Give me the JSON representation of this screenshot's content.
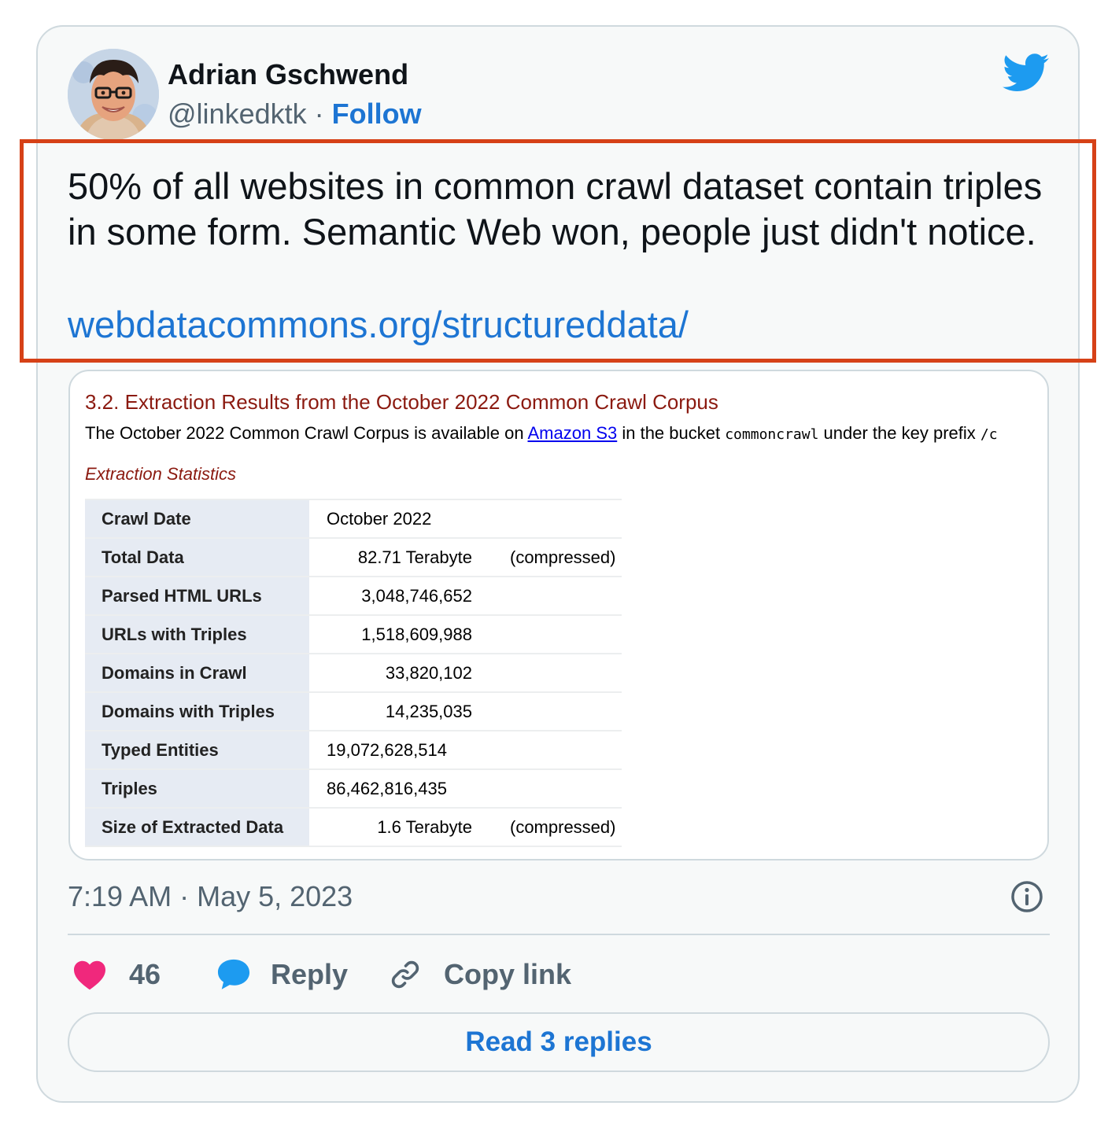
{
  "author": {
    "name": "Adrian Gschwend",
    "handle": "@linkedktk",
    "separator": "·",
    "follow_label": "Follow"
  },
  "tweet": {
    "text": "50% of all websites in common crawl dataset contain triples in some form. Semantic Web won, people just didn't notice.",
    "link": "webdatacommons.org/structureddata/"
  },
  "embed": {
    "section_title": "3.2. Extraction Results from the October 2022 Common Crawl Corpus",
    "desc_before": "The October 2022 Common Crawl Corpus is available on ",
    "desc_link": "Amazon S3",
    "desc_mid": " in the bucket ",
    "desc_code1": "commoncrawl",
    "desc_after": " under the key prefix ",
    "desc_code2": "/c",
    "stats_label": "Extraction Statistics",
    "rows": [
      {
        "key": "Crawl Date",
        "value": "October 2022",
        "note": ""
      },
      {
        "key": "Total Data",
        "value": "82.71 Terabyte",
        "note": "(compressed)"
      },
      {
        "key": "Parsed HTML URLs",
        "value": "3,048,746,652",
        "note": ""
      },
      {
        "key": "URLs with Triples",
        "value": "1,518,609,988",
        "note": ""
      },
      {
        "key": "Domains in Crawl",
        "value": "33,820,102",
        "note": ""
      },
      {
        "key": "Domains with Triples",
        "value": "14,235,035",
        "note": ""
      },
      {
        "key": "Typed Entities",
        "value": "19,072,628,514",
        "note": ""
      },
      {
        "key": "Triples",
        "value": "86,462,816,435",
        "note": ""
      },
      {
        "key": "Size of Extracted Data",
        "value": "1.6 Terabyte",
        "note": "(compressed)"
      }
    ]
  },
  "timestamp": "7:19 AM · May 5, 2023",
  "actions": {
    "like_count": "46",
    "reply_label": "Reply",
    "copy_link_label": "Copy link"
  },
  "read_replies_label": "Read 3 replies",
  "colors": {
    "accent": "#1d75d3",
    "highlight_border": "#d64117",
    "like": "#f0287c",
    "section_title": "#8b1a10"
  },
  "icons": [
    "twitter-bird-icon",
    "info-icon",
    "heart-icon",
    "speech-bubble-icon",
    "link-icon"
  ]
}
